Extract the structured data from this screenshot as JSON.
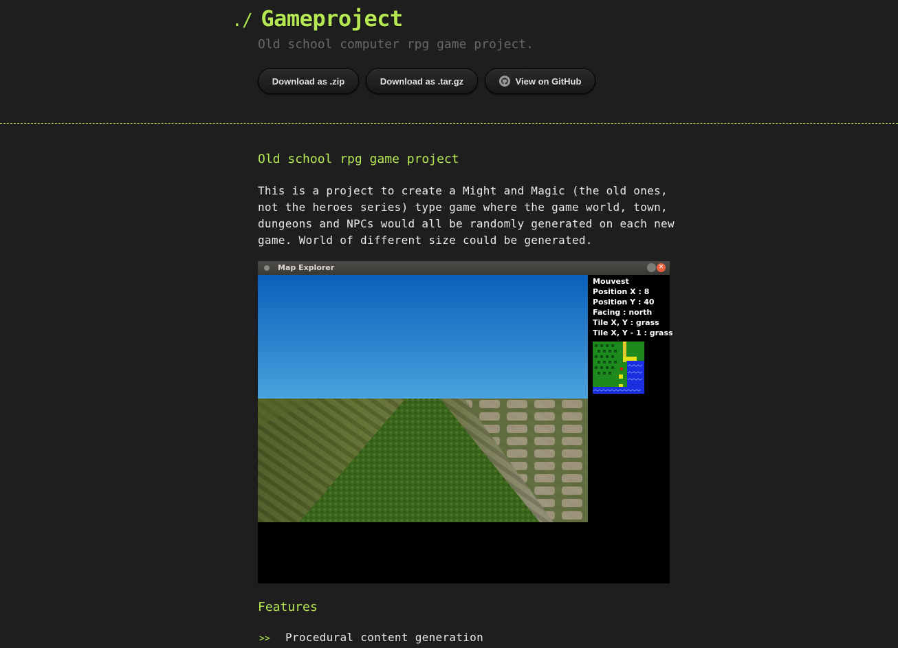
{
  "header": {
    "title_prefix": "./",
    "title": "Gameproject",
    "subtitle": "Old school computer rpg game project.",
    "buttons": {
      "zip": "Download as .zip",
      "tar": "Download as .tar.gz",
      "github": "View on GitHub"
    }
  },
  "main": {
    "heading": "Old school rpg game project",
    "paragraph": "This is a project to create a Might and Magic (the old ones, not the heroes series) type game where the game world, town, dungeons and NPCs would all be randomly generated on each new game. World of different size could be generated.",
    "screenshot": {
      "window_title": "Map Explorer",
      "hud": {
        "name": "Mouvest",
        "position_x": "Position X : 8",
        "position_y": "Position Y : 40",
        "facing": "Facing : north",
        "tile_xy": "Tile X, Y : grass",
        "tile_xy_minus1": "Tile X, Y - 1 : grass"
      }
    },
    "features_heading": "Features",
    "features": {
      "bullet": ">>",
      "items": [
        "Procedural content generation"
      ]
    }
  },
  "colors": {
    "accent": "#b5e853",
    "background": "#1e1e1e",
    "text": "#eaeaea",
    "muted": "#686868"
  }
}
